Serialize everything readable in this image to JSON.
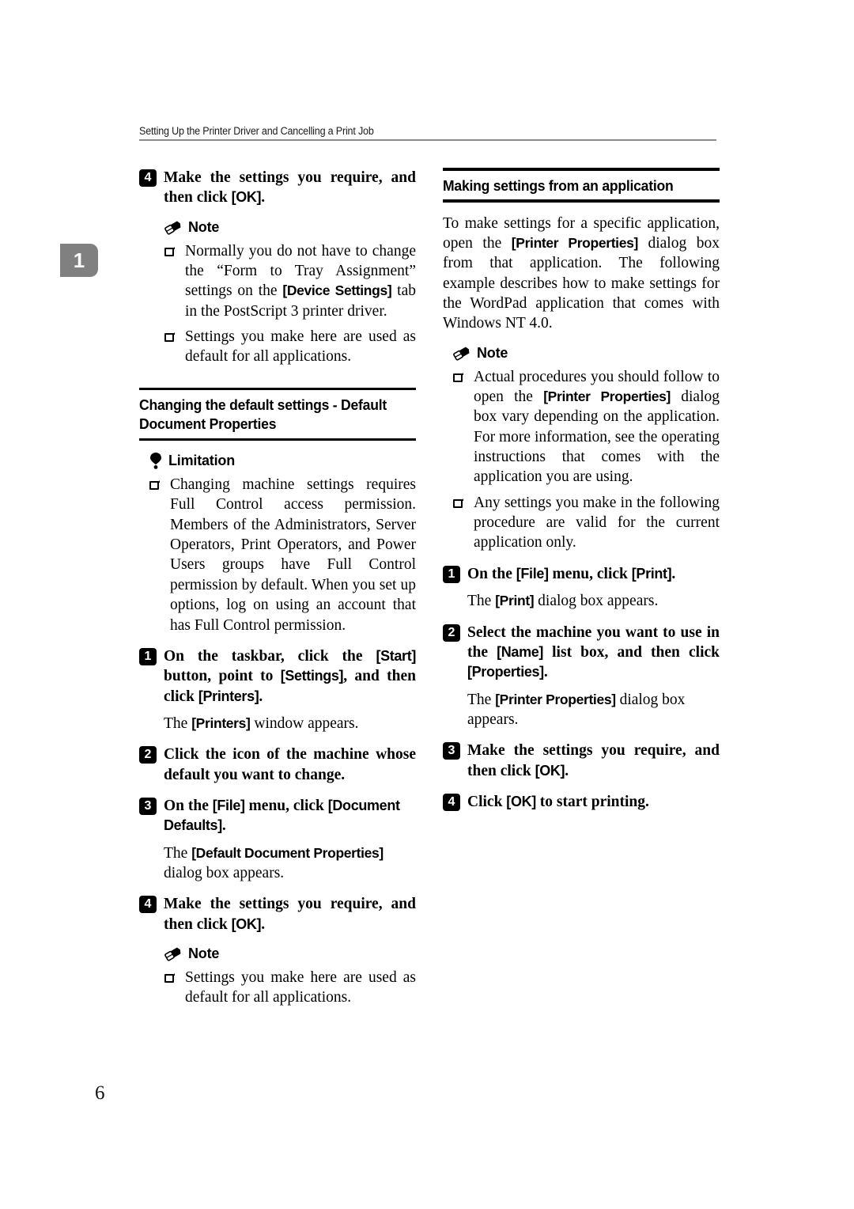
{
  "header": {
    "running_title": "Setting Up the Printer Driver and Cancelling a Print Job"
  },
  "chapter_tab": {
    "number": "1"
  },
  "page_number": "6",
  "icons": {
    "note": "pencil-eraser-icon",
    "limitation": "exclamation-balloon-icon",
    "bullet": "hollow-square-bullet-icon"
  },
  "left_column": {
    "step_4": {
      "badge": "4",
      "text_a": "Make the settings you require, and then click ",
      "ui_ok": "[OK]",
      "text_b": "."
    },
    "note_label": "Note",
    "note_items": [
      {
        "part1": "Normally you do not have to change the “Form to Tray Assignment” settings on the ",
        "ui": "[Device Settings]",
        "part2": " tab in the PostScript 3 printer driver."
      },
      {
        "part1": "Settings you make here are used as default for all applications.",
        "ui": "",
        "part2": ""
      }
    ],
    "section_title": "Changing the default settings - Default Document Properties",
    "limitation_label": "Limitation",
    "limitation_items": [
      "Changing machine settings requires Full Control access permission. Members of the Administrators, Server Operators, Print Operators, and Power Users groups have Full Control permission by default. When you set up options, log on using an account that has Full Control permission."
    ],
    "step_1": {
      "badge": "1",
      "t1": "On the taskbar, click the ",
      "ui1": "[Start]",
      "t2": " button, point to ",
      "ui2": "[Settings]",
      "t3": ", and then click ",
      "ui3": "[Printers]",
      "t4": "."
    },
    "step_1_result": {
      "t1": "The ",
      "ui1": "[Printers]",
      "t2": " window appears."
    },
    "step_2": {
      "badge": "2",
      "text": "Click the icon of the machine whose default you want to change."
    },
    "step_3": {
      "badge": "3",
      "t1": "On the ",
      "ui1": "[File]",
      "t2": " menu, click ",
      "ui2": "[Document Defaults]",
      "t3": "."
    },
    "step_3_result": {
      "t1": "The ",
      "ui1": "[Default Document Properties]",
      "t2": " dialog box appears."
    },
    "step_4b": {
      "badge": "4",
      "t1": "Make the settings you require, and then click ",
      "ui1": "[OK]",
      "t2": "."
    },
    "note_label_2": "Note",
    "note_items_2": [
      "Settings you make here are used as default for all applications."
    ]
  },
  "right_column": {
    "section_title": "Making settings from an application",
    "intro": {
      "t1": "To make settings for a specific application, open the ",
      "ui1": "[Printer Properties]",
      "t2": " dialog box from that application. The following example describes how to make settings for the WordPad application that comes with Windows NT 4.0."
    },
    "note_label": "Note",
    "note_items": [
      {
        "t1": "Actual procedures you should follow to open the ",
        "ui1": "[Printer Properties]",
        "t2": " dialog box vary depending on the application. For more information, see the operating instructions that comes with the application you are using."
      },
      {
        "t1": "Any settings you make in the following procedure are valid for the current application only.",
        "ui1": "",
        "t2": ""
      }
    ],
    "step_1": {
      "badge": "1",
      "t1": "On the ",
      "ui1": "[File]",
      "t2": " menu, click ",
      "ui2": "[Print]",
      "t3": "."
    },
    "step_1_result": {
      "t1": "The ",
      "ui1": "[Print]",
      "t2": " dialog box appears."
    },
    "step_2": {
      "badge": "2",
      "t1": "Select the machine you want to use in the ",
      "ui1": "[Name]",
      "t2": " list box, and then click ",
      "ui2": "[Properties]",
      "t3": "."
    },
    "step_2_result": {
      "t1": "The ",
      "ui1": "[Printer Properties]",
      "t2": " dialog box appears."
    },
    "step_3": {
      "badge": "3",
      "t1": "Make the settings you require, and then click ",
      "ui1": "[OK]",
      "t2": "."
    },
    "step_4": {
      "badge": "4",
      "t1": "Click ",
      "ui1": "[OK]",
      "t2": " to start printing."
    }
  }
}
